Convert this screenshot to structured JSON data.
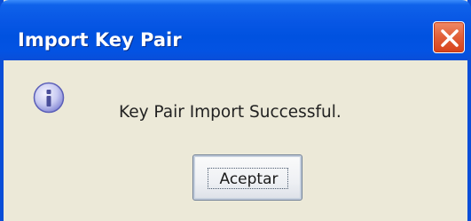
{
  "window": {
    "title": "Import Key Pair",
    "close_icon": "close-icon"
  },
  "dialog": {
    "icon": "info-icon",
    "message": "Key Pair Import Successful.",
    "ok_label": "Aceptar"
  },
  "colors": {
    "titlebar": "#0a4ed8",
    "close_button": "#d6421a",
    "body": "#ece9d8",
    "info_icon": "#8c8fd8"
  }
}
